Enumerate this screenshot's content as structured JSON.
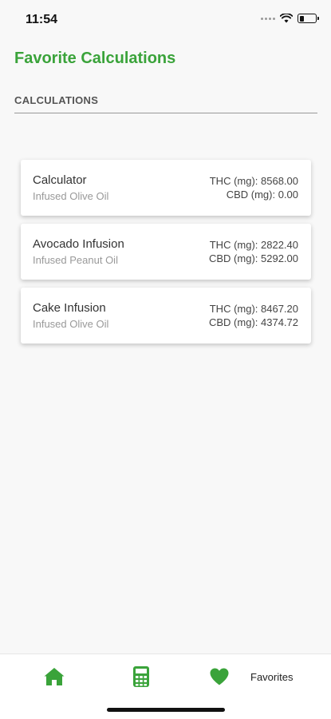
{
  "status_bar": {
    "time": "11:54"
  },
  "header": {
    "title": "Favorite Calculations"
  },
  "section": {
    "label": "CALCULATIONS"
  },
  "calculations": [
    {
      "name": "Calculator",
      "oil": "Infused Olive Oil",
      "thc": "THC (mg): 8568.00",
      "cbd": "CBD (mg): 0.00"
    },
    {
      "name": "Avocado Infusion",
      "oil": "Infused Peanut Oil",
      "thc": "THC (mg): 2822.40",
      "cbd": "CBD (mg): 5292.00"
    },
    {
      "name": "Cake Infusion",
      "oil": "Infused Olive Oil",
      "thc": "THC (mg): 8467.20",
      "cbd": "CBD (mg): 4374.72"
    }
  ],
  "tab_bar": {
    "favorites_label": "Favorites",
    "icons": [
      "home-icon",
      "calculator-icon",
      "heart-icon"
    ]
  },
  "colors": {
    "accent": "#3aa33a",
    "background": "#f8f8f8"
  }
}
